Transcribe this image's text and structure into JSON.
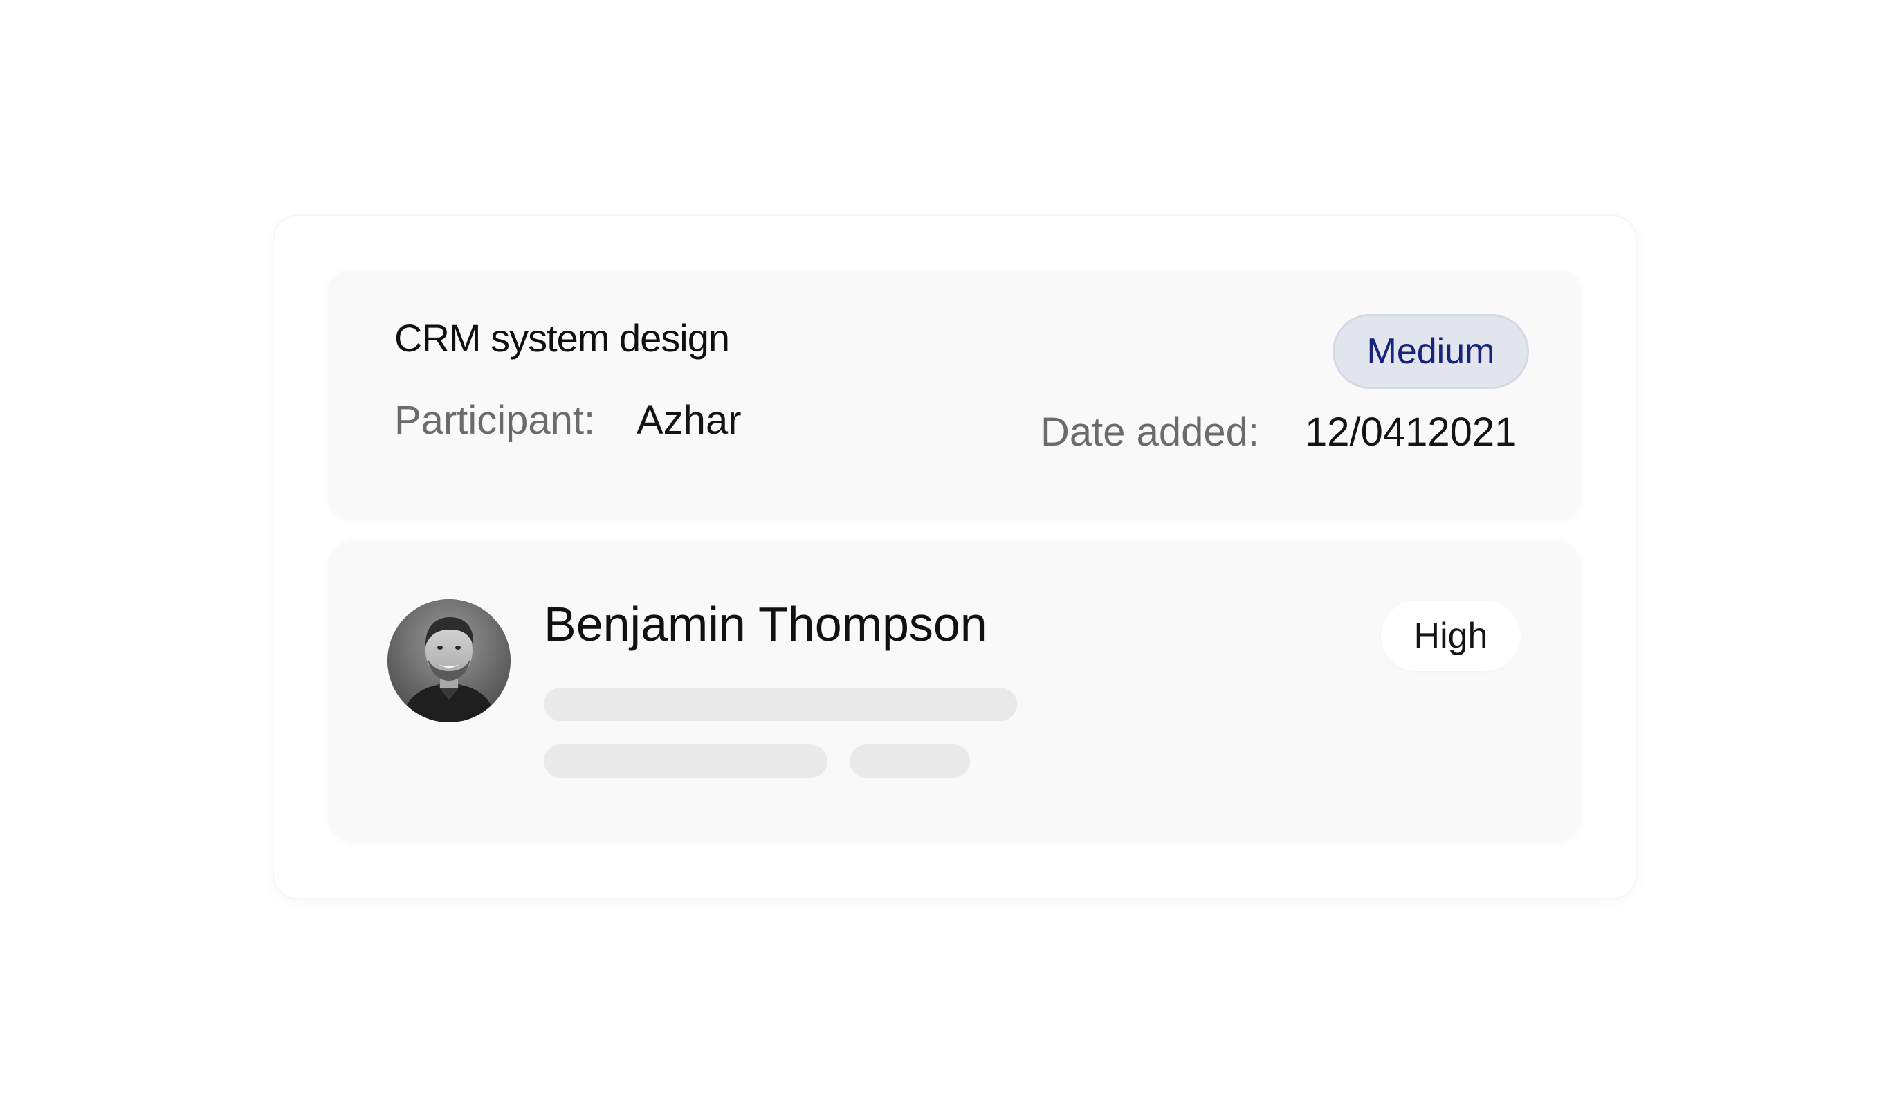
{
  "task_card": {
    "title": "CRM system design",
    "priority": "Medium",
    "participant_label": "Participant:",
    "participant_value": "Azhar",
    "date_label": "Date added:",
    "date_value": "12/0412021"
  },
  "person_card": {
    "name": "Benjamin Thompson",
    "priority": "High",
    "avatar_icon": "user-avatar-photo"
  },
  "colors": {
    "background": "#ffffff",
    "card": "#f9f9f9",
    "medium_badge_bg": "#e3e5ee",
    "medium_badge_text": "#16247a",
    "skeleton": "#e9e9e9"
  }
}
